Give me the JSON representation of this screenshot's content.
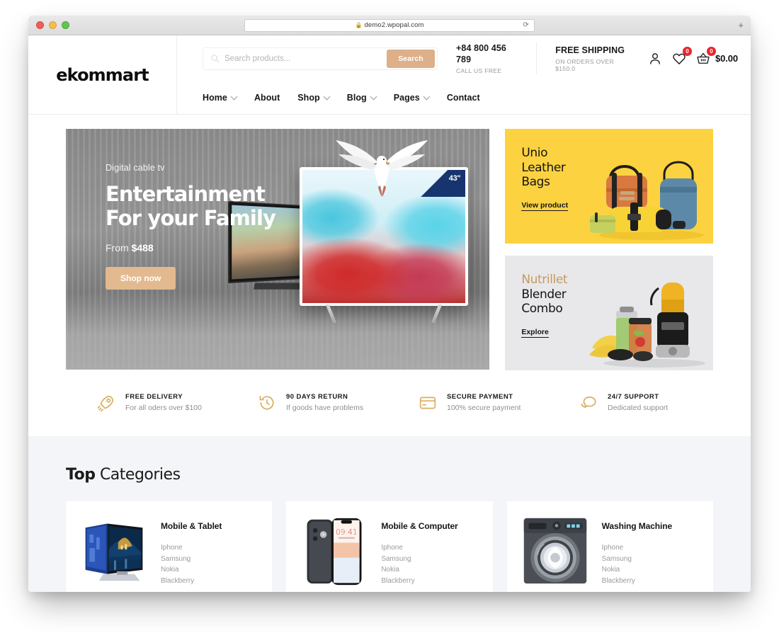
{
  "browser": {
    "url": "demo2.wpopal.com",
    "lock_icon": "lock-icon",
    "reload_icon": "reload-icon",
    "new_tab_icon": "plus-icon"
  },
  "header": {
    "brand": "ekommart",
    "search": {
      "placeholder": "Search products...",
      "value": "",
      "button_label": "Search"
    },
    "phone": {
      "number": "+84 800 456 789",
      "caption": "CALL US FREE"
    },
    "shipping": {
      "title": "FREE SHIPPING",
      "caption": "ON ORDERS OVER $150.0"
    },
    "actions": {
      "account_icon": "user-icon",
      "wishlist_icon": "heart-icon",
      "wishlist_count": "0",
      "cart_icon": "basket-icon",
      "cart_count": "0",
      "cart_total": "$0.00"
    }
  },
  "nav": {
    "items": [
      {
        "label": "Home",
        "has_dropdown": true
      },
      {
        "label": "About",
        "has_dropdown": false
      },
      {
        "label": "Shop",
        "has_dropdown": true
      },
      {
        "label": "Blog",
        "has_dropdown": true
      },
      {
        "label": "Pages",
        "has_dropdown": true
      },
      {
        "label": "Contact",
        "has_dropdown": false
      }
    ]
  },
  "hero": {
    "eyebrow": "Digital cable tv",
    "title_line1": "Entertainment",
    "title_line2": "For your Family",
    "price_prefix": "From ",
    "price_value": "$488",
    "cta_label": "Shop now",
    "tv_badge": "43\""
  },
  "promos": [
    {
      "title_line1": "Unio",
      "title_line2": "Leather",
      "title_line3": "Bags",
      "link_label": "View product",
      "background": "#fcd241",
      "accent_on_first_line": false
    },
    {
      "title_line1": "Nutrillet",
      "title_line2": "Blender",
      "title_line3": "Combo",
      "link_label": "Explore",
      "background": "#e8e8ea",
      "accent_color": "#c39b5f",
      "accent_on_first_line": true
    }
  ],
  "features": [
    {
      "icon": "rocket-icon",
      "title": "FREE DELIVERY",
      "subtitle": "For all oders over $100"
    },
    {
      "icon": "clock-back-icon",
      "title": "90 DAYS RETURN",
      "subtitle": "If goods have problems"
    },
    {
      "icon": "credit-card-icon",
      "title": "SECURE PAYMENT",
      "subtitle": "100% secure payment"
    },
    {
      "icon": "chat-bubbles-icon",
      "title": "24/7 SUPPORT",
      "subtitle": "Dedicated support"
    }
  ],
  "categories_section": {
    "title_bold": "Top",
    "title_rest": " Categories",
    "cards": [
      {
        "name": "Mobile & Tablet",
        "thumb": "tv-thumb",
        "items": [
          "Iphone",
          "Samsung",
          "Nokia",
          "Blackberry"
        ]
      },
      {
        "name": "Mobile & Computer",
        "thumb": "smartphone-thumb",
        "items": [
          "Iphone",
          "Samsung",
          "Nokia",
          "Blackberry"
        ]
      },
      {
        "name": "Washing Machine",
        "thumb": "washing-machine-thumb",
        "items": [
          "Iphone",
          "Samsung",
          "Nokia",
          "Blackberry"
        ]
      }
    ]
  },
  "colors": {
    "accent_tan": "#ddb089",
    "badge_red": "#e8262b",
    "feature_gold": "#d9b062",
    "promo_yellow": "#fcd241",
    "section_bg": "#f4f5f8"
  }
}
